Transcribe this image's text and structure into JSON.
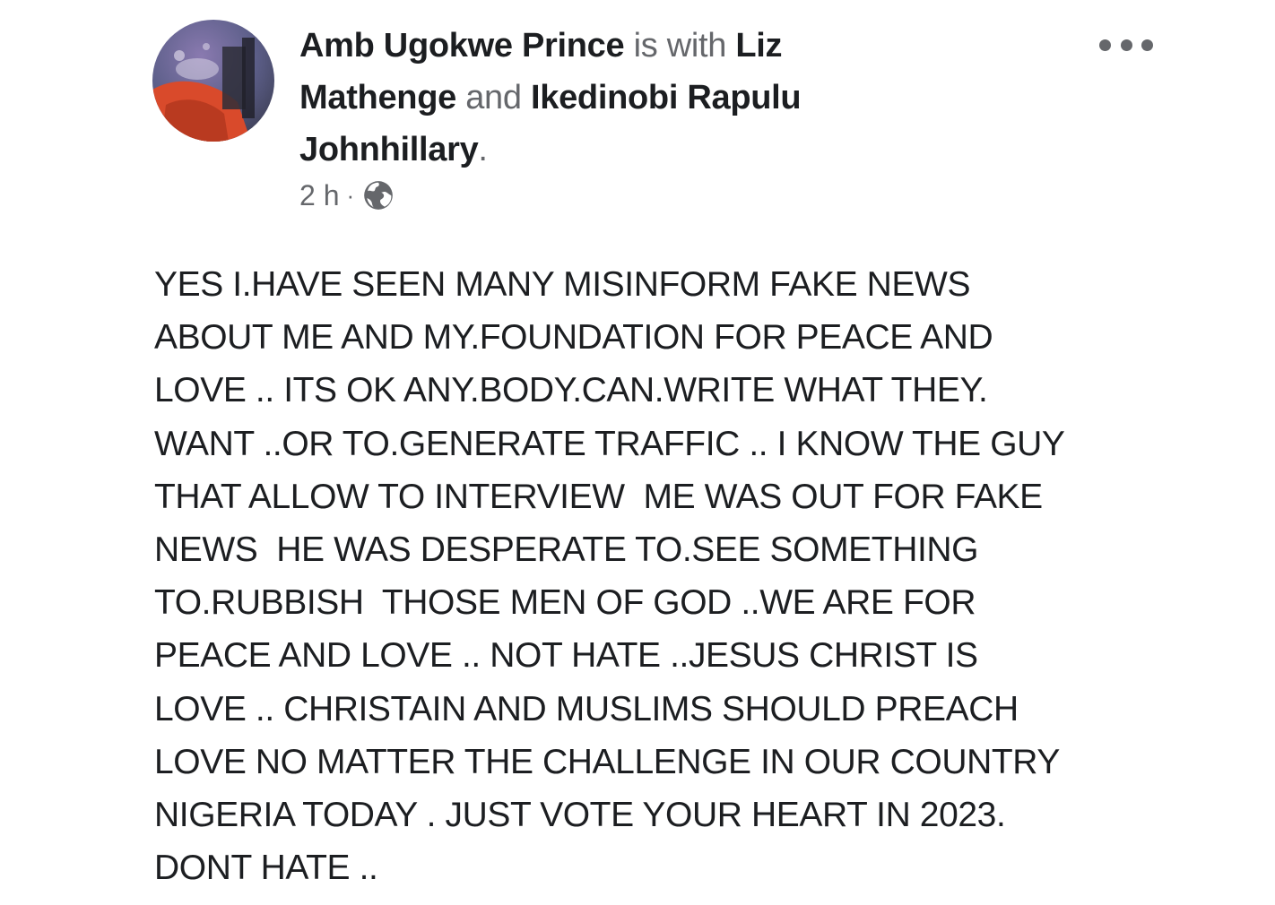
{
  "post": {
    "author": "Amb Ugokwe Prince",
    "with_text": "is with",
    "tagged": [
      {
        "name_part1": "Liz",
        "name_part2": "Mathenge"
      },
      {
        "name_part1": "Ikedinobi Rapulu",
        "name_part2": "Johnhillary"
      }
    ],
    "and_text": "and",
    "period": ".",
    "time": "2 h",
    "dot": "·",
    "privacy_icon": "globe-icon",
    "more_icon": "more-options-icon",
    "avatar": "profile-photo",
    "body_lines": [
      "YES I.HAVE SEEN MANY MISINFORM FAKE NEWS",
      "ABOUT ME AND MY.FOUNDATION FOR PEACE AND",
      "LOVE .. ITS OK ANY.BODY.CAN.WRITE WHAT THEY.",
      "WANT ..OR TO.GENERATE TRAFFIC .. I KNOW THE GUY",
      "THAT ALLOW TO INTERVIEW  ME WAS OUT FOR FAKE",
      "NEWS  HE WAS DESPERATE TO.SEE SOMETHING",
      "TO.RUBBISH  THOSE MEN OF GOD ..WE ARE FOR",
      "PEACE AND LOVE .. NOT HATE ..JESUS CHRIST IS",
      "LOVE .. CHRISTAIN AND MUSLIMS SHOULD PREACH",
      "LOVE NO MATTER THE CHALLENGE IN OUR COUNTRY",
      "NIGERIA TODAY . JUST VOTE YOUR HEART IN 2023.",
      "DONT HATE .."
    ]
  },
  "colors": {
    "text": "#1c1e21",
    "muted": "#65676b",
    "background": "#ffffff"
  }
}
